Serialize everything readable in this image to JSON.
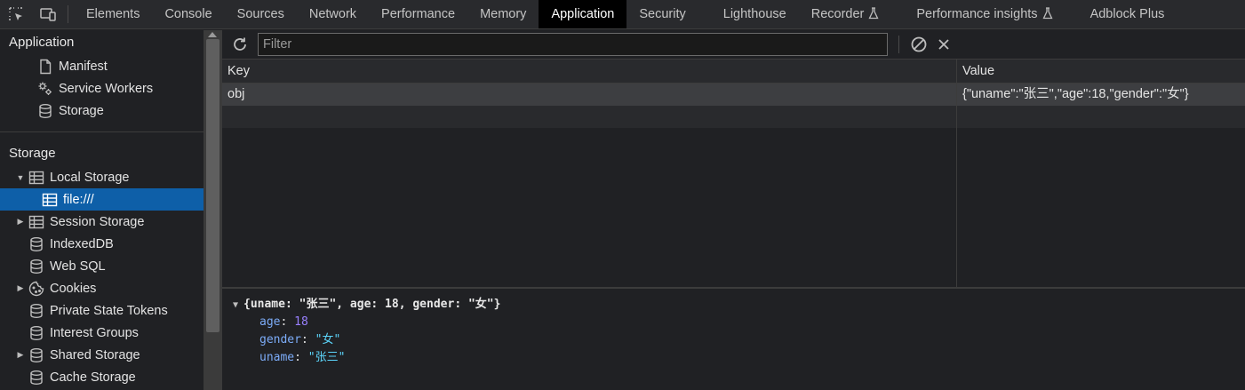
{
  "toolbar_icons": [
    "inspect-element-icon",
    "device-toolbar-icon"
  ],
  "tabs": [
    {
      "label": "Elements",
      "active": false
    },
    {
      "label": "Console",
      "active": false
    },
    {
      "label": "Sources",
      "active": false
    },
    {
      "label": "Network",
      "active": false
    },
    {
      "label": "Performance",
      "active": false
    },
    {
      "label": "Memory",
      "active": false
    },
    {
      "label": "Application",
      "active": true
    },
    {
      "label": "Security",
      "active": false
    },
    {
      "label": "Lighthouse",
      "active": false
    },
    {
      "label": "Recorder",
      "active": false,
      "experimental": true
    },
    {
      "label": "Performance insights",
      "active": false,
      "experimental": true
    },
    {
      "label": "Adblock Plus",
      "active": false
    }
  ],
  "sidebar": {
    "application_header": "Application",
    "application_items": [
      {
        "label": "Manifest",
        "icon": "document-icon"
      },
      {
        "label": "Service Workers",
        "icon": "gears-icon"
      },
      {
        "label": "Storage",
        "icon": "database-icon"
      }
    ],
    "storage_header": "Storage",
    "storage_items": [
      {
        "label": "Local Storage",
        "icon": "table-icon",
        "arrow": "expanded",
        "indent": 0,
        "selected": false
      },
      {
        "label": "file:///",
        "icon": "table-icon",
        "arrow": "none",
        "indent": 1,
        "selected": true
      },
      {
        "label": "Session Storage",
        "icon": "table-icon",
        "arrow": "collapsed",
        "indent": 0,
        "selected": false
      },
      {
        "label": "IndexedDB",
        "icon": "database-icon",
        "arrow": "none",
        "indent": 0,
        "selected": false
      },
      {
        "label": "Web SQL",
        "icon": "database-icon",
        "arrow": "none",
        "indent": 0,
        "selected": false
      },
      {
        "label": "Cookies",
        "icon": "cookie-icon",
        "arrow": "collapsed",
        "indent": 0,
        "selected": false
      },
      {
        "label": "Private State Tokens",
        "icon": "database-icon",
        "arrow": "none",
        "indent": 0,
        "selected": false
      },
      {
        "label": "Interest Groups",
        "icon": "database-icon",
        "arrow": "none",
        "indent": 0,
        "selected": false
      },
      {
        "label": "Shared Storage",
        "icon": "database-icon",
        "arrow": "collapsed",
        "indent": 0,
        "selected": false
      },
      {
        "label": "Cache Storage",
        "icon": "database-icon",
        "arrow": "none",
        "indent": 0,
        "selected": false
      }
    ]
  },
  "main": {
    "filter_placeholder": "Filter",
    "filter_value": "",
    "columns": {
      "key": "Key",
      "value": "Value"
    },
    "rows": [
      {
        "key": "obj",
        "value": "{\"uname\":\"张三\",\"age\":18,\"gender\":\"女\"}",
        "selected": true
      },
      {
        "key": "",
        "value": "",
        "selected": false
      }
    ],
    "preview": {
      "summary": "{uname: \"张三\", age: 18, gender: \"女\"}",
      "props": [
        {
          "key": "age",
          "value": "18",
          "kind": "number"
        },
        {
          "key": "gender",
          "value": "\"女\"",
          "kind": "string"
        },
        {
          "key": "uname",
          "value": "\"张三\"",
          "kind": "string"
        }
      ]
    }
  },
  "colors": {
    "accent_selected": "#0e5fa8",
    "active_tab_bg": "#000000",
    "background": "#202124",
    "json_key": "#7cacf8",
    "json_number": "#9980ff",
    "json_string": "#5cd5fb"
  }
}
